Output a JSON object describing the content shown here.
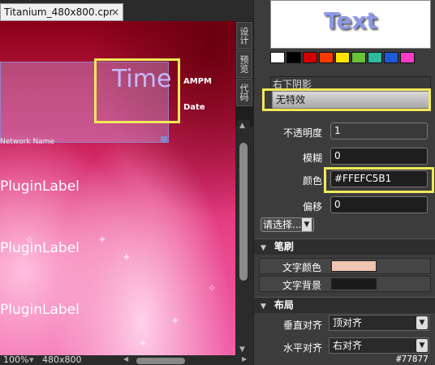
{
  "editor": {
    "tab_title": "Titanium_480x800.cpr",
    "tab_close": "×",
    "canvas": {
      "time": "Time",
      "ampm": "AMPM",
      "date": "Date",
      "network": "Network Name",
      "plugin_labels": [
        "PluginLabel",
        "PluginLabel",
        "PluginLabel"
      ]
    },
    "vertical_tabs": [
      "设计",
      "预览",
      "代码"
    ],
    "status": {
      "zoom": "100%",
      "resolution": "480x800"
    }
  },
  "panel": {
    "preview_text": "Text",
    "swatches": [
      "#ffffff",
      "#000000",
      "#d40000",
      "#ff3a00",
      "#ffe600",
      "#6ac23a",
      "#2fb9a0",
      "#1e5ad8",
      "#ff3cc8"
    ],
    "shadow_section": "右下阴影",
    "effect_button": "无特效",
    "opacity_label": "不透明度",
    "opacity_value": "1",
    "blur_label": "模糊",
    "blur_value": "0",
    "color_label": "颜色",
    "color_value": "#FFEFC5B1",
    "offset_label": "偏移",
    "offset_value": "0",
    "select_button": "请选择...",
    "brush_section": "笔刷",
    "text_color_label": "文字颜色",
    "text_color_swatch": "#efc5b1",
    "text_bg_label": "文字背景",
    "text_bg_swatch": "#1a1a1a",
    "layout_section": "布局",
    "valign_label": "垂直对齐",
    "valign_value": "顶对齐",
    "halign_label": "水平对齐",
    "halign_value": "右对齐"
  },
  "watermark": "#77877"
}
